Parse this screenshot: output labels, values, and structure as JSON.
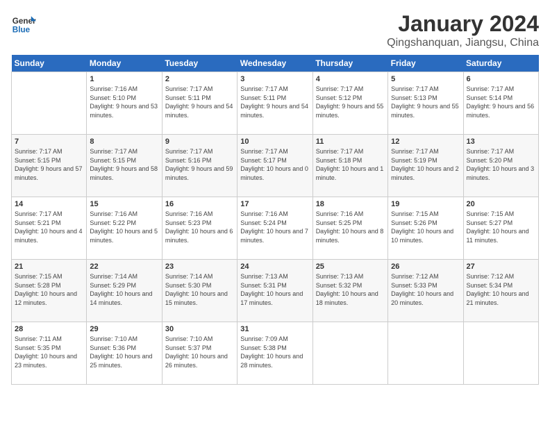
{
  "header": {
    "logo_line1": "General",
    "logo_line2": "Blue",
    "title": "January 2024",
    "subtitle": "Qingshanquan, Jiangsu, China"
  },
  "days_of_week": [
    "Sunday",
    "Monday",
    "Tuesday",
    "Wednesday",
    "Thursday",
    "Friday",
    "Saturday"
  ],
  "weeks": [
    [
      {
        "day": "",
        "sunrise": "",
        "sunset": "",
        "daylight": ""
      },
      {
        "day": "1",
        "sunrise": "Sunrise: 7:16 AM",
        "sunset": "Sunset: 5:10 PM",
        "daylight": "Daylight: 9 hours and 53 minutes."
      },
      {
        "day": "2",
        "sunrise": "Sunrise: 7:17 AM",
        "sunset": "Sunset: 5:11 PM",
        "daylight": "Daylight: 9 hours and 54 minutes."
      },
      {
        "day": "3",
        "sunrise": "Sunrise: 7:17 AM",
        "sunset": "Sunset: 5:11 PM",
        "daylight": "Daylight: 9 hours and 54 minutes."
      },
      {
        "day": "4",
        "sunrise": "Sunrise: 7:17 AM",
        "sunset": "Sunset: 5:12 PM",
        "daylight": "Daylight: 9 hours and 55 minutes."
      },
      {
        "day": "5",
        "sunrise": "Sunrise: 7:17 AM",
        "sunset": "Sunset: 5:13 PM",
        "daylight": "Daylight: 9 hours and 55 minutes."
      },
      {
        "day": "6",
        "sunrise": "Sunrise: 7:17 AM",
        "sunset": "Sunset: 5:14 PM",
        "daylight": "Daylight: 9 hours and 56 minutes."
      }
    ],
    [
      {
        "day": "7",
        "sunrise": "Sunrise: 7:17 AM",
        "sunset": "Sunset: 5:15 PM",
        "daylight": "Daylight: 9 hours and 57 minutes."
      },
      {
        "day": "8",
        "sunrise": "Sunrise: 7:17 AM",
        "sunset": "Sunset: 5:15 PM",
        "daylight": "Daylight: 9 hours and 58 minutes."
      },
      {
        "day": "9",
        "sunrise": "Sunrise: 7:17 AM",
        "sunset": "Sunset: 5:16 PM",
        "daylight": "Daylight: 9 hours and 59 minutes."
      },
      {
        "day": "10",
        "sunrise": "Sunrise: 7:17 AM",
        "sunset": "Sunset: 5:17 PM",
        "daylight": "Daylight: 10 hours and 0 minutes."
      },
      {
        "day": "11",
        "sunrise": "Sunrise: 7:17 AM",
        "sunset": "Sunset: 5:18 PM",
        "daylight": "Daylight: 10 hours and 1 minute."
      },
      {
        "day": "12",
        "sunrise": "Sunrise: 7:17 AM",
        "sunset": "Sunset: 5:19 PM",
        "daylight": "Daylight: 10 hours and 2 minutes."
      },
      {
        "day": "13",
        "sunrise": "Sunrise: 7:17 AM",
        "sunset": "Sunset: 5:20 PM",
        "daylight": "Daylight: 10 hours and 3 minutes."
      }
    ],
    [
      {
        "day": "14",
        "sunrise": "Sunrise: 7:17 AM",
        "sunset": "Sunset: 5:21 PM",
        "daylight": "Daylight: 10 hours and 4 minutes."
      },
      {
        "day": "15",
        "sunrise": "Sunrise: 7:16 AM",
        "sunset": "Sunset: 5:22 PM",
        "daylight": "Daylight: 10 hours and 5 minutes."
      },
      {
        "day": "16",
        "sunrise": "Sunrise: 7:16 AM",
        "sunset": "Sunset: 5:23 PM",
        "daylight": "Daylight: 10 hours and 6 minutes."
      },
      {
        "day": "17",
        "sunrise": "Sunrise: 7:16 AM",
        "sunset": "Sunset: 5:24 PM",
        "daylight": "Daylight: 10 hours and 7 minutes."
      },
      {
        "day": "18",
        "sunrise": "Sunrise: 7:16 AM",
        "sunset": "Sunset: 5:25 PM",
        "daylight": "Daylight: 10 hours and 8 minutes."
      },
      {
        "day": "19",
        "sunrise": "Sunrise: 7:15 AM",
        "sunset": "Sunset: 5:26 PM",
        "daylight": "Daylight: 10 hours and 10 minutes."
      },
      {
        "day": "20",
        "sunrise": "Sunrise: 7:15 AM",
        "sunset": "Sunset: 5:27 PM",
        "daylight": "Daylight: 10 hours and 11 minutes."
      }
    ],
    [
      {
        "day": "21",
        "sunrise": "Sunrise: 7:15 AM",
        "sunset": "Sunset: 5:28 PM",
        "daylight": "Daylight: 10 hours and 12 minutes."
      },
      {
        "day": "22",
        "sunrise": "Sunrise: 7:14 AM",
        "sunset": "Sunset: 5:29 PM",
        "daylight": "Daylight: 10 hours and 14 minutes."
      },
      {
        "day": "23",
        "sunrise": "Sunrise: 7:14 AM",
        "sunset": "Sunset: 5:30 PM",
        "daylight": "Daylight: 10 hours and 15 minutes."
      },
      {
        "day": "24",
        "sunrise": "Sunrise: 7:13 AM",
        "sunset": "Sunset: 5:31 PM",
        "daylight": "Daylight: 10 hours and 17 minutes."
      },
      {
        "day": "25",
        "sunrise": "Sunrise: 7:13 AM",
        "sunset": "Sunset: 5:32 PM",
        "daylight": "Daylight: 10 hours and 18 minutes."
      },
      {
        "day": "26",
        "sunrise": "Sunrise: 7:12 AM",
        "sunset": "Sunset: 5:33 PM",
        "daylight": "Daylight: 10 hours and 20 minutes."
      },
      {
        "day": "27",
        "sunrise": "Sunrise: 7:12 AM",
        "sunset": "Sunset: 5:34 PM",
        "daylight": "Daylight: 10 hours and 21 minutes."
      }
    ],
    [
      {
        "day": "28",
        "sunrise": "Sunrise: 7:11 AM",
        "sunset": "Sunset: 5:35 PM",
        "daylight": "Daylight: 10 hours and 23 minutes."
      },
      {
        "day": "29",
        "sunrise": "Sunrise: 7:10 AM",
        "sunset": "Sunset: 5:36 PM",
        "daylight": "Daylight: 10 hours and 25 minutes."
      },
      {
        "day": "30",
        "sunrise": "Sunrise: 7:10 AM",
        "sunset": "Sunset: 5:37 PM",
        "daylight": "Daylight: 10 hours and 26 minutes."
      },
      {
        "day": "31",
        "sunrise": "Sunrise: 7:09 AM",
        "sunset": "Sunset: 5:38 PM",
        "daylight": "Daylight: 10 hours and 28 minutes."
      },
      {
        "day": "",
        "sunrise": "",
        "sunset": "",
        "daylight": ""
      },
      {
        "day": "",
        "sunrise": "",
        "sunset": "",
        "daylight": ""
      },
      {
        "day": "",
        "sunrise": "",
        "sunset": "",
        "daylight": ""
      }
    ]
  ]
}
